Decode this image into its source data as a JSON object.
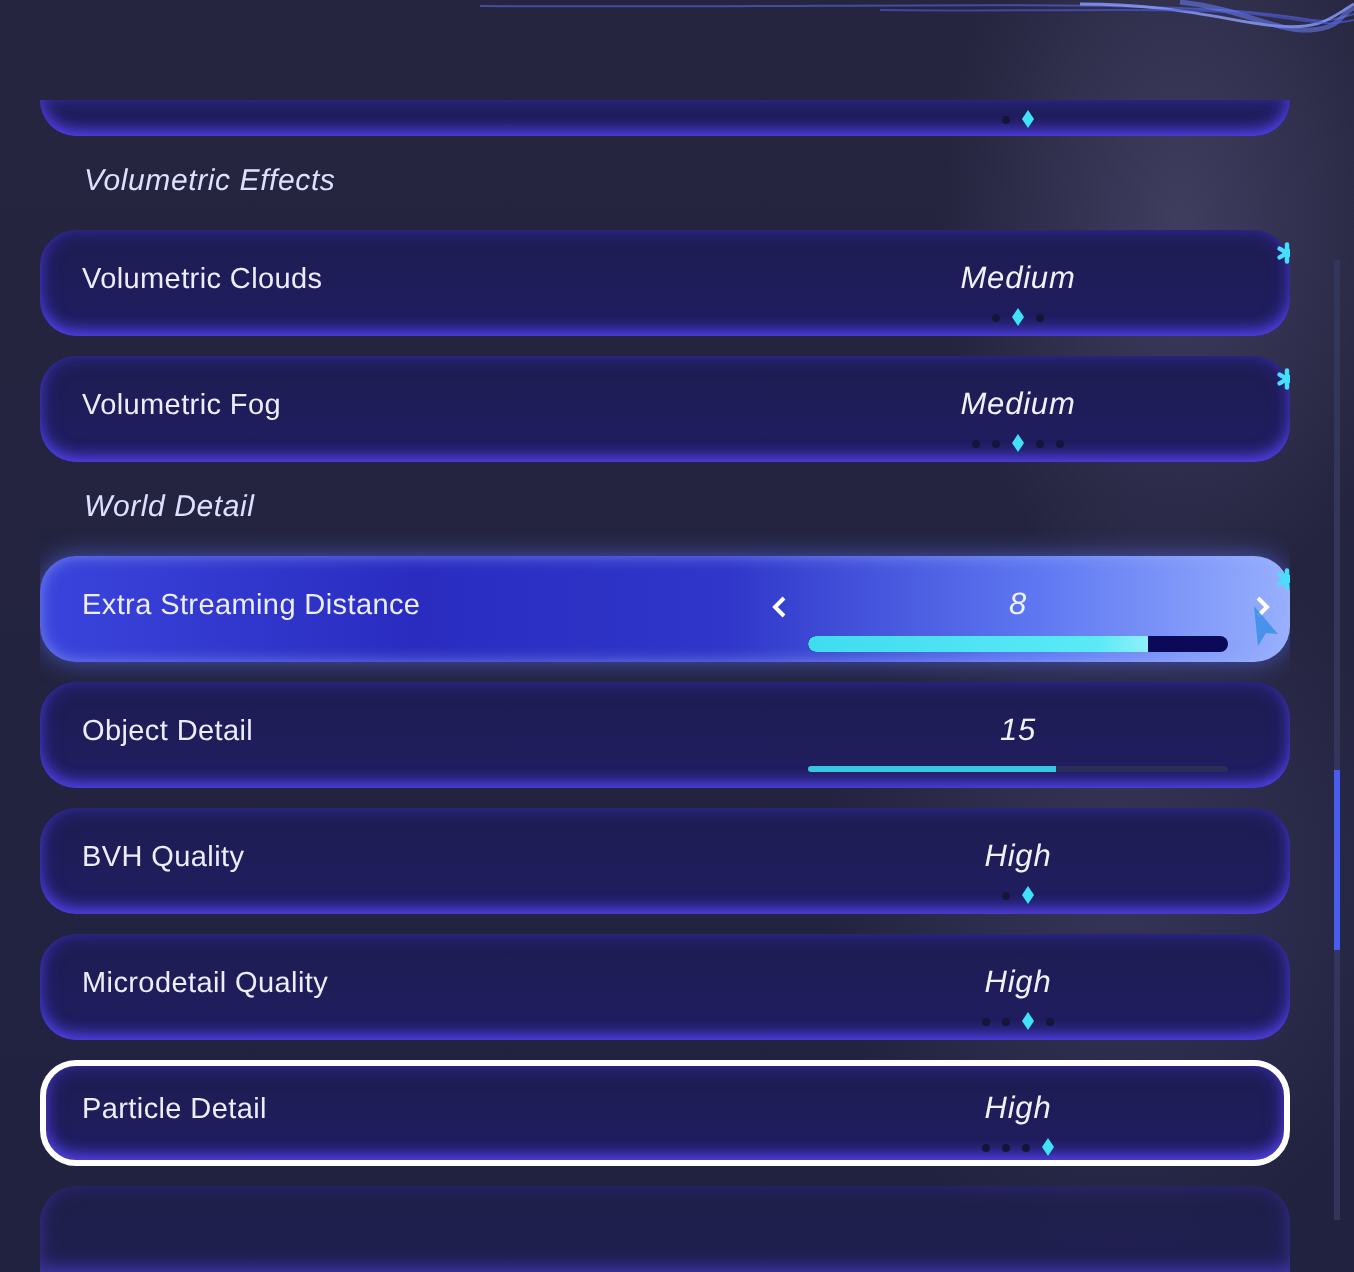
{
  "settings": {
    "items": [
      {
        "kind": "select",
        "hovered": false,
        "selected": false,
        "dots": [
          {
            "selected": false
          },
          {
            "selected": true
          }
        ]
      },
      {
        "kind": "header",
        "label": "Volumetric Effects"
      },
      {
        "kind": "select",
        "label": "Volumetric Clouds",
        "value": "Medium",
        "hovered": false,
        "selected": false,
        "modified": true,
        "dots": [
          {
            "selected": false
          },
          {
            "selected": true
          },
          {
            "selected": false
          }
        ]
      },
      {
        "kind": "select",
        "label": "Volumetric Fog",
        "value": "Medium",
        "hovered": false,
        "selected": false,
        "modified": true,
        "dots": [
          {
            "selected": false
          },
          {
            "selected": false
          },
          {
            "selected": true
          },
          {
            "selected": false
          },
          {
            "selected": false
          }
        ]
      },
      {
        "kind": "header",
        "label": "World Detail"
      },
      {
        "kind": "slider",
        "label": "Extra Streaming Distance",
        "value": "8",
        "hovered": true,
        "selected": false,
        "modified": true,
        "level": 0.81
      },
      {
        "kind": "slider",
        "label": "Object Detail",
        "value": "15",
        "hovered": false,
        "selected": false,
        "modified": false,
        "level": 0.59
      },
      {
        "kind": "select",
        "label": "BVH Quality",
        "value": "High",
        "hovered": false,
        "selected": false,
        "modified": false,
        "dots": [
          {
            "selected": false
          },
          {
            "selected": true
          }
        ]
      },
      {
        "kind": "select",
        "label": "Microdetail Quality",
        "value": "High",
        "hovered": false,
        "selected": false,
        "modified": false,
        "dots": [
          {
            "selected": false
          },
          {
            "selected": false
          },
          {
            "selected": true
          },
          {
            "selected": false
          }
        ]
      },
      {
        "kind": "select",
        "label": "Particle Detail",
        "value": "High",
        "hovered": false,
        "selected": true,
        "modified": false,
        "dots": [
          {
            "selected": false
          },
          {
            "selected": false
          },
          {
            "selected": false
          },
          {
            "selected": true
          }
        ]
      },
      {
        "kind": "select",
        "hovered": false,
        "selected": false
      }
    ]
  }
}
